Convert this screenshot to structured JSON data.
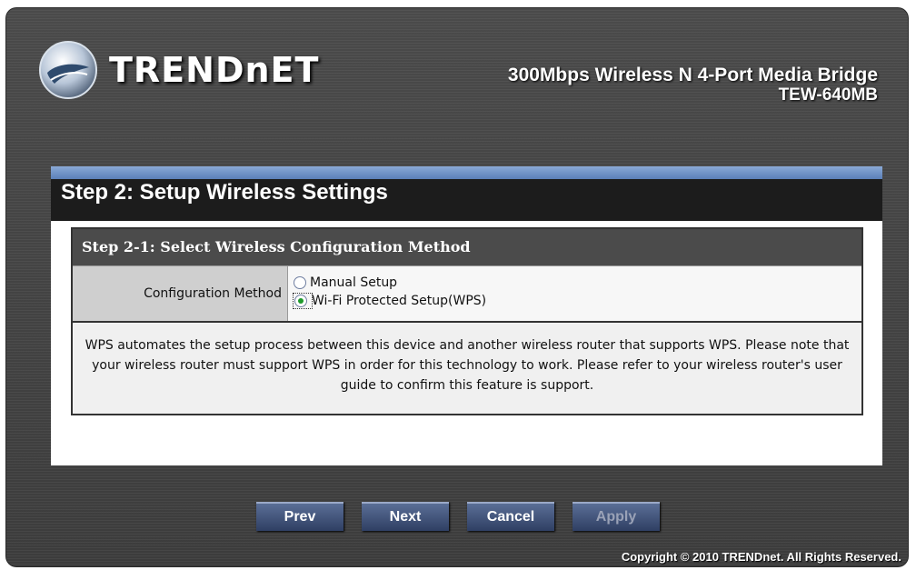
{
  "brand": {
    "logo_text": "TRENDnET",
    "product_name": "300Mbps Wireless N 4-Port Media Bridge",
    "model": "TEW-640MB"
  },
  "panel": {
    "title": "Step 2: Setup Wireless Settings",
    "section_title": "Step 2-1: Select Wireless Configuration Method",
    "config_label": "Configuration Method",
    "options": [
      {
        "label": "Manual Setup",
        "selected": false
      },
      {
        "label": "Wi-Fi Protected Setup(WPS)",
        "selected": true
      }
    ],
    "description": "WPS automates the setup process between this device and another wireless router that supports WPS. Please note that your wireless router must support WPS in order for this technology to work. Please refer to your wireless router's user guide to confirm this feature is support."
  },
  "buttons": {
    "prev": "Prev",
    "next": "Next",
    "cancel": "Cancel",
    "apply": "Apply"
  },
  "footer": {
    "copyright": "Copyright © 2010 TRENDnet. All Rights Reserved."
  },
  "colors": {
    "accent_bar": "#6f8fc7",
    "title_bar": "#1c1c1c",
    "selected_radio": "#1e9a2b"
  },
  "icons": {
    "logo": "trendnet-logo-icon"
  }
}
